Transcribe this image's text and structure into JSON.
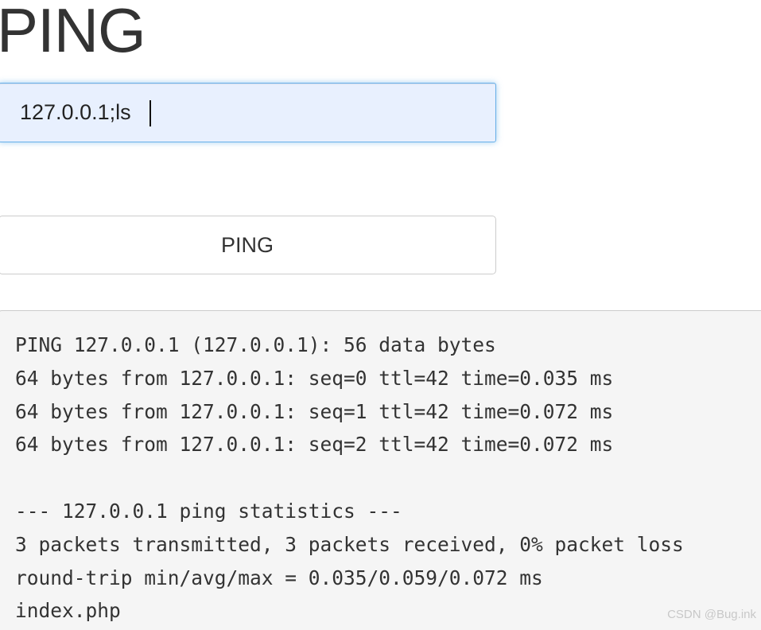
{
  "page": {
    "title": "PING"
  },
  "form": {
    "ip_input_value": "127.0.0.1;ls",
    "ping_button_label": "PING"
  },
  "output": {
    "text": "PING 127.0.0.1 (127.0.0.1): 56 data bytes\n64 bytes from 127.0.0.1: seq=0 ttl=42 time=0.035 ms\n64 bytes from 127.0.0.1: seq=1 ttl=42 time=0.072 ms\n64 bytes from 127.0.0.1: seq=2 ttl=42 time=0.072 ms\n\n--- 127.0.0.1 ping statistics ---\n3 packets transmitted, 3 packets received, 0% packet loss\nround-trip min/avg/max = 0.035/0.059/0.072 ms\nindex.php"
  },
  "watermark": {
    "text": "CSDN @Bug.ink"
  },
  "colors": {
    "input_focus_border": "#66afe9",
    "input_autofill_bg": "#e8f0fe",
    "output_bg": "#f5f5f5"
  }
}
